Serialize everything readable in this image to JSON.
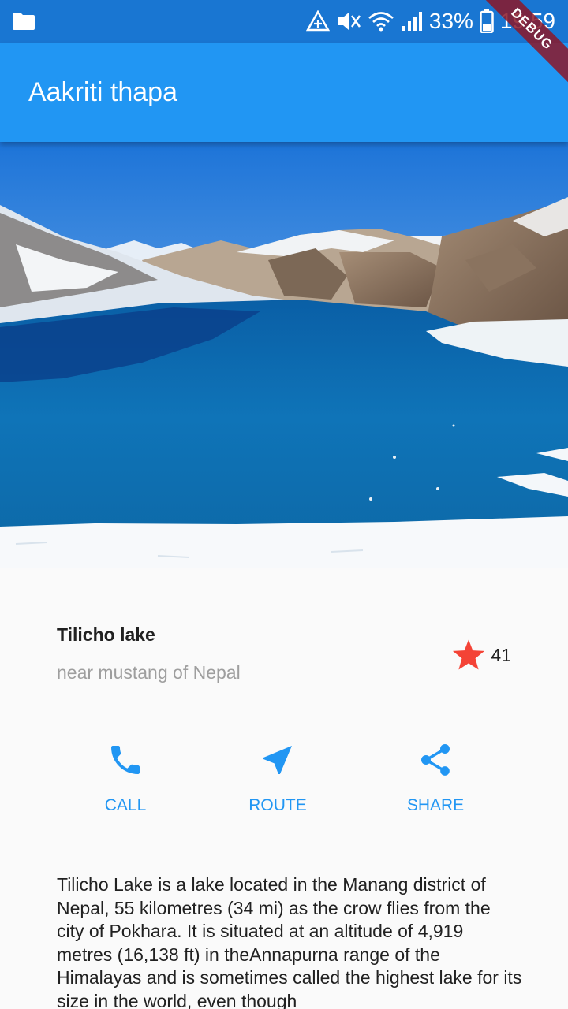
{
  "status_bar": {
    "battery": "33%",
    "time": "19:59",
    "icons": [
      "folder-icon",
      "data-saver-icon",
      "mute-icon",
      "wifi-icon",
      "signal-icon",
      "battery-icon"
    ]
  },
  "debug_banner": "DEBUG",
  "app_bar": {
    "title": "Aakriti thapa"
  },
  "place": {
    "name": "Tilicho lake",
    "subtitle": "near mustang of Nepal",
    "rating_count": "41",
    "star_color": "#f44336"
  },
  "actions": [
    {
      "label": "CALL",
      "icon": "phone-icon"
    },
    {
      "label": "ROUTE",
      "icon": "navigation-icon"
    },
    {
      "label": "SHARE",
      "icon": "share-icon"
    }
  ],
  "accent_color": "#2196f3",
  "description": "Tilicho Lake is a lake located in the Manang district of Nepal, 55 kilometres (34 mi) as the crow flies from the city of Pokhara. It is situated at an altitude of 4,919 metres (16,138 ft) in theAnnapurna range of the Himalayas and is sometimes called the highest lake for its size in the world, even though"
}
